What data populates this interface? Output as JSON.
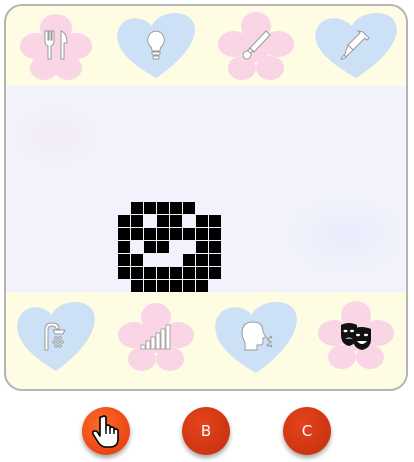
{
  "top_icons": [
    {
      "icon": "utensils-icon",
      "bg": "flower",
      "bg_color": "#f9d5e5"
    },
    {
      "icon": "lightbulb-icon",
      "bg": "heart",
      "bg_color": "#cde1f6"
    },
    {
      "icon": "baseball-bat-icon",
      "bg": "flower",
      "bg_color": "#f9d5e5"
    },
    {
      "icon": "syringe-icon",
      "bg": "heart",
      "bg_color": "#cde1f6"
    }
  ],
  "bottom_icons": [
    {
      "icon": "shower-icon",
      "bg": "heart",
      "bg_color": "#cde1f6",
      "selected": false
    },
    {
      "icon": "volume-bars-icon",
      "bg": "flower",
      "bg_color": "#f9d5e5",
      "selected": false
    },
    {
      "icon": "talking-head-icon",
      "bg": "heart",
      "bg_color": "#cde1f6",
      "selected": false
    },
    {
      "icon": "theater-masks-icon",
      "bg": "flower",
      "bg_color": "#f9d5e5",
      "selected": true
    }
  ],
  "colors": {
    "panel_bg": "#fffce4",
    "stage_bg": "#f1f2fb",
    "icon_inactive": "#ffffff",
    "icon_active": "#111111",
    "button_active": "#f2541b",
    "button": "#d03a12"
  },
  "sprite": {
    "pattern": [
      "01111100",
      "11011011",
      "11111111",
      "10110011",
      "11000111",
      "11111111",
      "01111110"
    ]
  },
  "buttons": {
    "a_label": "",
    "b_label": "B",
    "c_label": "C"
  }
}
